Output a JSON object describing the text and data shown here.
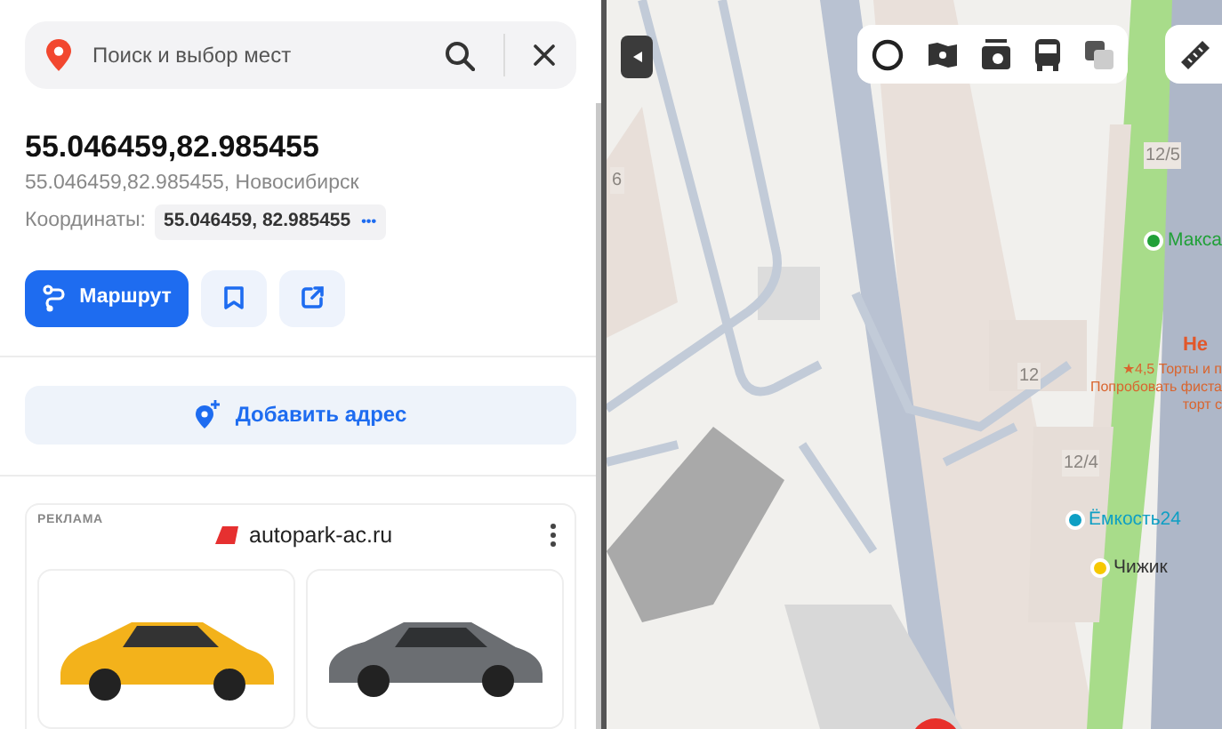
{
  "search": {
    "placeholder": "Поиск и выбор мест"
  },
  "place": {
    "title": "55.046459,82.985455",
    "subtitle": "55.046459,82.985455, Новосибирск",
    "coords_label": "Координаты:",
    "coords_value": "55.046459, 82.985455",
    "coords_more": "•••"
  },
  "actions": {
    "route": "Маршрут"
  },
  "add_address": "Добавить адрес",
  "ad": {
    "label": "РЕКЛАМА",
    "site": "autopark-ac.ru"
  },
  "map": {
    "labels": [
      {
        "kind": "house",
        "text": "6"
      },
      {
        "kind": "house",
        "text": "12/5"
      },
      {
        "kind": "poi",
        "text": "Макса",
        "color": "#21a038"
      },
      {
        "kind": "title",
        "text": "Не"
      },
      {
        "kind": "note",
        "text": "★4,5 Торты и п"
      },
      {
        "kind": "note",
        "text": "Попробовать фиста"
      },
      {
        "kind": "note",
        "text": "торт с"
      },
      {
        "kind": "house",
        "text": "12"
      },
      {
        "kind": "house",
        "text": "12/4"
      },
      {
        "kind": "poi",
        "text": "Ёмкость24",
        "color": "#0e9fc4"
      },
      {
        "kind": "poi",
        "text": "Чижик",
        "color": "#f6c800"
      }
    ]
  }
}
